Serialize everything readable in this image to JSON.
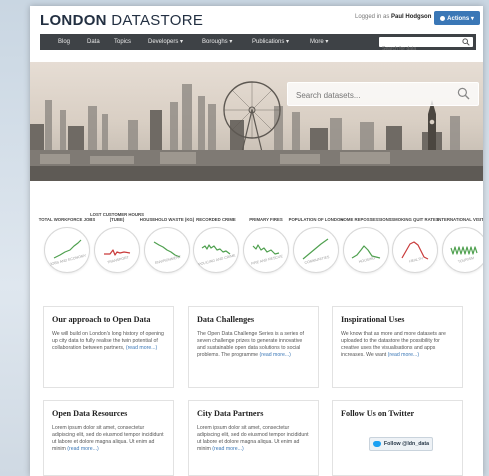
{
  "header": {
    "logo_part1": "LONDON",
    "logo_part2": "DATASTORE",
    "logged_prefix": "Logged in as",
    "logged_user": "Paul Hodgson",
    "actions_label": "Actions ▾"
  },
  "nav": {
    "items": [
      "Blog",
      "Data",
      "Topics",
      "Developers ▾",
      "Boroughs ▾",
      "Publications ▾",
      "More ▾"
    ],
    "search_placeholder": "Search for data"
  },
  "hero": {
    "search_placeholder": "Search datasets..."
  },
  "stats": [
    {
      "label": "TOTAL WORKFORCE JOBS",
      "category": "Jobs and Economy",
      "color": "#4fa04f"
    },
    {
      "label": "LOST CUSTOMER HOURS (TUBE)",
      "category": "Transport",
      "color": "#c93b3b"
    },
    {
      "label": "HOUSEHOLD WASTE (KG)",
      "category": "Environment",
      "color": "#4fa04f"
    },
    {
      "label": "RECORDED CRIME",
      "category": "Policing and Crime",
      "color": "#4fa04f"
    },
    {
      "label": "PRIMARY FIRES",
      "category": "Fire and Rescue",
      "color": "#4fa04f"
    },
    {
      "label": "POPULATION OF LONDON",
      "category": "Communities",
      "color": "#4fa04f"
    },
    {
      "label": "HOME REPOSSESSIONS",
      "category": "Housing",
      "color": "#4fa04f"
    },
    {
      "label": "SMOKING QUIT RATES",
      "category": "Health",
      "color": "#c93b3b"
    },
    {
      "label": "INTERNATIONAL VISITORS",
      "category": "Tourism",
      "color": "#4fa04f"
    }
  ],
  "cards": [
    {
      "title": "Our approach to Open Data",
      "body": "We will build on London's long history of opening up city data to fully realise the twin potential of collaboration between partners,",
      "more": "(read more...)"
    },
    {
      "title": "Data Challenges",
      "body": "The Open Data Challenge Series is a series of seven challenge prizes to generate innovative and sustainable open data solutions to social problems. The programme",
      "more": "(read more...)"
    },
    {
      "title": "Inspirational Uses",
      "body": "We know that as more and more datasets are uploaded to the datastore the possibility for creative uses the visualisations and apps increases. We want",
      "more": "(read more...)"
    },
    {
      "title": "Open Data Resources",
      "body": "Lorem ipsum dolor sit amet, consectetur adipiscing elit, sed do eiusmod tempor incididunt ut labore et dolore magna aliqua. Ut enim ad minim",
      "more": "(read more...)"
    },
    {
      "title": "City Data Partners",
      "body": "Lorem ipsum dolor sit amet, consectetur adipiscing elit, sed do eiusmod tempor incididunt ut labore et dolore magna aliqua. Ut enim ad minim",
      "more": "(read more...)"
    },
    {
      "title": "Follow Us on Twitter",
      "body": "",
      "more": ""
    }
  ],
  "twitter": {
    "button_label": "Follow @ldn_data"
  },
  "colors": {
    "brand": "#233042",
    "accent": "#3a77b6",
    "nav": "#3e4246"
  }
}
